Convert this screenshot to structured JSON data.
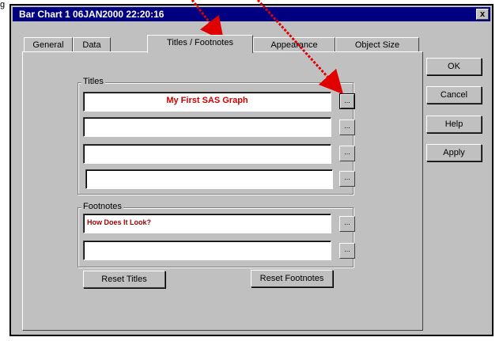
{
  "caption_fragment": "g",
  "window": {
    "title": "Bar Chart 1 06JAN2000 22:20:16",
    "close_label": "x"
  },
  "tabs": [
    {
      "label": "General"
    },
    {
      "label": "Data"
    },
    {
      "label": "Titles / Footnotes"
    },
    {
      "label": "Appearance"
    },
    {
      "label": "Object Size"
    }
  ],
  "titles_group": {
    "label": "Titles",
    "fields": [
      "My First SAS Graph",
      "",
      "",
      ""
    ],
    "browse_label": "..."
  },
  "footnotes_group": {
    "label": "Footnotes",
    "fields": [
      "How Does It Look?",
      ""
    ],
    "browse_label": "..."
  },
  "buttons": {
    "reset_titles": "Reset Titles",
    "reset_footnotes": "Reset Footnotes",
    "ok": "OK",
    "cancel": "Cancel",
    "help": "Help",
    "apply": "Apply"
  },
  "colors": {
    "titlebar": "#000080",
    "face": "#c0c0c0",
    "arrow": "#e00000",
    "title_text": "#cc0000"
  }
}
